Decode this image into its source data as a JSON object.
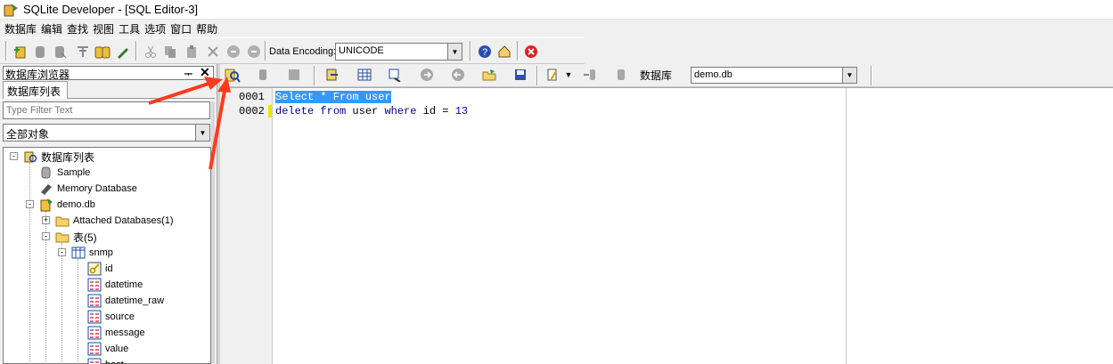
{
  "window": {
    "title": "SQLite Developer - [SQL Editor-3]"
  },
  "menu": [
    "数据库",
    "编辑",
    "查找",
    "视图",
    "工具",
    "选项",
    "窗口",
    "帮助"
  ],
  "toolbar": {
    "encoding_label": "Data Encoding:",
    "encoding_value": "UNICODE"
  },
  "browser": {
    "panel_title": "数据库浏览器",
    "pin": "ᆍ",
    "close": "✕",
    "tab": "数据库列表",
    "filter_placeholder": "Type Filter Text",
    "object_filter": "全部对象"
  },
  "tree": {
    "root": "数据库列表",
    "items": [
      "Sample",
      "Memory Database",
      "demo.db",
      "Attached Databases(1)",
      "表(5)",
      "snmp",
      "id",
      "datetime",
      "datetime_raw",
      "source",
      "message",
      "value",
      "host"
    ]
  },
  "editor_toolbar": {
    "db_label": "数据库",
    "db_value": "demo.db"
  },
  "editor": {
    "line_numbers": [
      "0001",
      "0002"
    ],
    "lines": [
      "Select * From user",
      "delete from user where id = 13"
    ]
  },
  "colors": {
    "selection": "#3399ff",
    "annotation_arrow": "#ff3b1f",
    "keyword": "#00008b"
  }
}
